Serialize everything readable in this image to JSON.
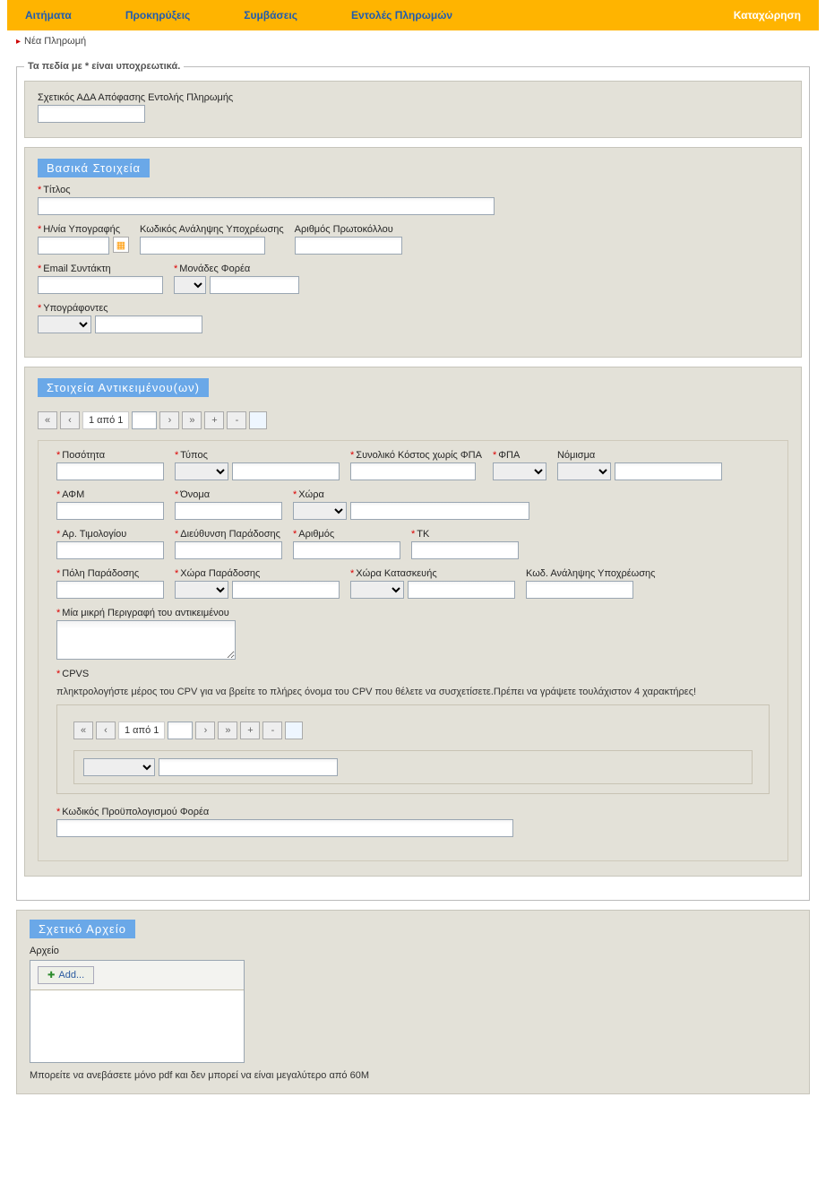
{
  "nav": {
    "items": [
      "Αιτήματα",
      "Προκηρύξεις",
      "Συμβάσεις",
      "Εντολές Πληρωμών"
    ],
    "right": "Καταχώρηση"
  },
  "breadcrumb": "Νέα Πληρωμή",
  "legend": "Τα πεδία με * είναι υποχρεωτικά.",
  "s1": {
    "ada_label": "Σχετικός ΑΔΑ Απόφασης Εντολής Πληρωμής"
  },
  "s2": {
    "title": "Βασικά Στοιχεία",
    "titlos": "Τίτλος",
    "date": "Η/νία Υπογραφής",
    "code": "Κωδικός Ανάληψης Υποχρέωσης",
    "prot": "Αριθμός Πρωτοκόλλου",
    "email": "Email Συντάκτη",
    "monades": "Μονάδες Φορέα",
    "signers": "Υπογράφοντες"
  },
  "s3": {
    "title": "Στοιχεία Αντικειμένου(ων)",
    "pager": "1 από 1",
    "add": "+",
    "del": "-",
    "pp": "«",
    "p": "‹",
    "n": "›",
    "nn": "»",
    "qty": "Ποσότητα",
    "type": "Τύπος",
    "total": "Συνολικό Κόστος χωρίς ΦΠΑ",
    "vat": "ΦΠΑ",
    "currency": "Νόμισμα",
    "afm": "ΑΦΜ",
    "name": "Όνομα",
    "country": "Χώρα",
    "invoice": "Αρ. Τιμολογίου",
    "addr": "Διεύθυνση Παράδοσης",
    "num": "Αριθμός",
    "tk": "ΤΚ",
    "city": "Πόλη Παράδοσης",
    "dcountry": "Χώρα Παράδοσης",
    "mcountry": "Χώρα Κατασκευής",
    "kcode": "Κωδ. Ανάληψης Υποχρέωσης",
    "desc": "Μία μικρή Περιγραφή του αντικειμένου",
    "cpvs": "CPVS",
    "cpvs_hint": "πληκτρολογήστε μέρος του CPV για να βρείτε το πλήρες όνομα του CPV που θέλετε να συσχετίσετε.Πρέπει να γράψετε τουλάχιστον 4 χαρακτήρες!",
    "budget": "Κωδικός Προϋπολογισμού Φορέα"
  },
  "s4": {
    "title": "Σχετικό Αρχείο",
    "file": "Αρχείο",
    "add": "Add...",
    "hint": "Μπορείτε να ανεβάσετε μόνο pdf και δεν μπορεί να είναι μεγαλύτερο από 60Μ"
  }
}
